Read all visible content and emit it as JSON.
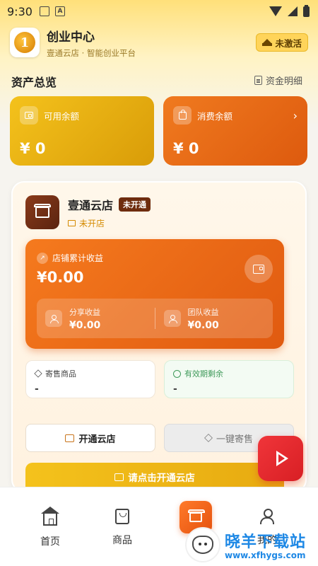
{
  "status_bar": {
    "time": "9:30"
  },
  "header": {
    "app_title": "创业中心",
    "app_subtitle": "壹通云店 · 智能创业平台",
    "status_badge": "未激活"
  },
  "assets": {
    "section_title": "资产总览",
    "detail_link": "资金明细",
    "available_label": "可用余额",
    "available_value": "¥ 0",
    "consume_label": "消费余额",
    "consume_value": "¥ 0"
  },
  "store": {
    "name": "壹通云店",
    "tag": "未开通",
    "status": "未开店",
    "income_label": "店铺累计收益",
    "income_value": "¥0.00",
    "share_label": "分享收益",
    "share_value": "¥0.00",
    "team_label": "团队收益",
    "team_value": "¥0.00",
    "consign_goods_label": "寄售商品",
    "consign_goods_value": "-",
    "validity_label": "有效期剩余",
    "validity_value": "-",
    "open_store_button": "开通云店",
    "one_click_consign_button": "一键寄售",
    "cta_button": "请点击开通云店"
  },
  "bottom_nav": {
    "home": "首页",
    "goods": "商品",
    "mine": "我的"
  },
  "watermark": {
    "title": "晓羊下载站",
    "url": "www.xfhygs.com"
  },
  "colors": {
    "gold": "#f4c21c",
    "orange": "#f07a1f",
    "red_fab": "#e0282d"
  }
}
